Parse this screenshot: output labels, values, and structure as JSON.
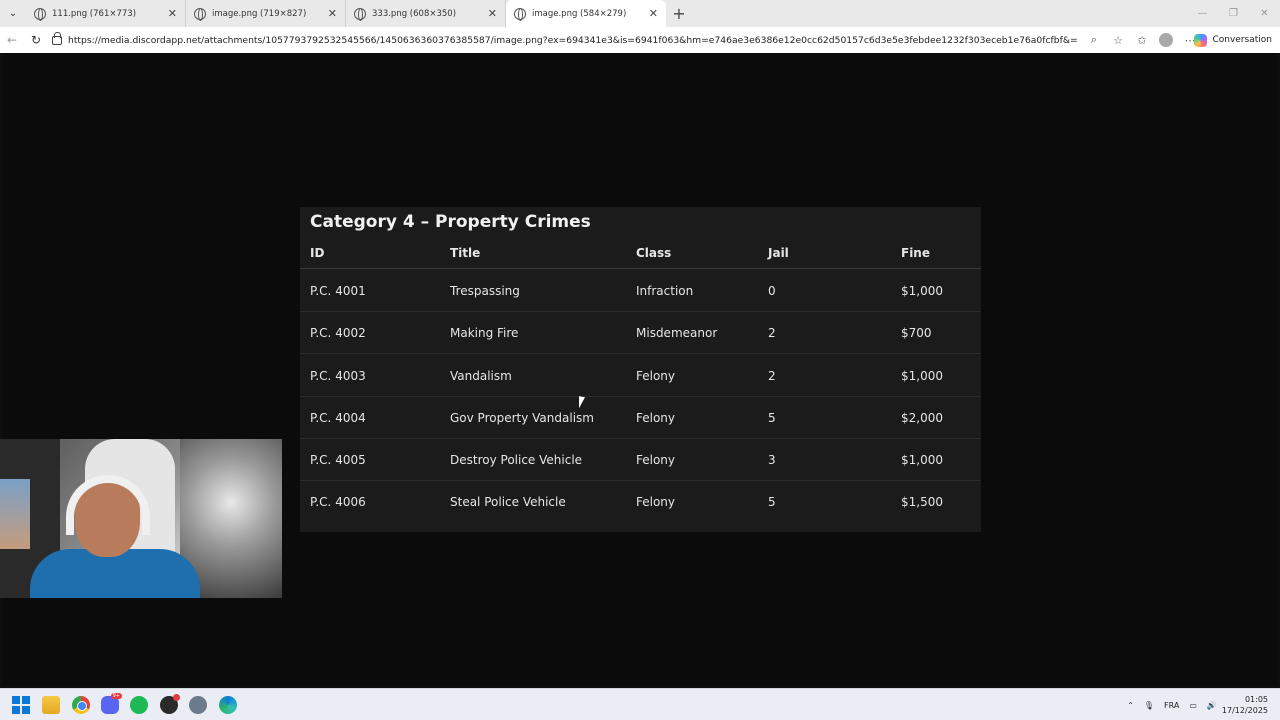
{
  "browser": {
    "tabs": [
      {
        "label": "111.png (761×773)",
        "active": false
      },
      {
        "label": "image.png (719×827)",
        "active": false
      },
      {
        "label": "333.png (608×350)",
        "active": false
      },
      {
        "label": "image.png (584×279)",
        "active": true
      }
    ],
    "new_tab_icon": "+",
    "url": "https://media.discordapp.net/attachments/1057793792532545566/1450636360376385587/image.png?ex=694341e3&is=6941f063&hm=e746ae3e6386e12e0cc62d50157c6d3e5e3febdee1232f303eceb1e76a0fcfbf&=&format=webp&quality=lo...",
    "copilot_label": "Conversation"
  },
  "table": {
    "title": "Category 4 – Property Crimes",
    "headers": [
      "ID",
      "Title",
      "Class",
      "Jail",
      "Fine"
    ],
    "rows": [
      [
        "P.C. 4001",
        "Trespassing",
        "Infraction",
        "0",
        "$1,000"
      ],
      [
        "P.C. 4002",
        "Making Fire",
        "Misdemeanor",
        "2",
        "$700"
      ],
      [
        "P.C. 4003",
        "Vandalism",
        "Felony",
        "2",
        "$1,000"
      ],
      [
        "P.C. 4004",
        "Gov Property Vandalism",
        "Felony",
        "5",
        "$2,000"
      ],
      [
        "P.C. 4005",
        "Destroy Police Vehicle",
        "Felony",
        "3",
        "$1,000"
      ],
      [
        "P.C. 4006",
        "Steal Police Vehicle",
        "Felony",
        "5",
        "$1,500"
      ]
    ]
  },
  "taskbar": {
    "language": "FRA",
    "time": "01:05",
    "date": "17/12/2025",
    "discord_badge": "9+"
  }
}
